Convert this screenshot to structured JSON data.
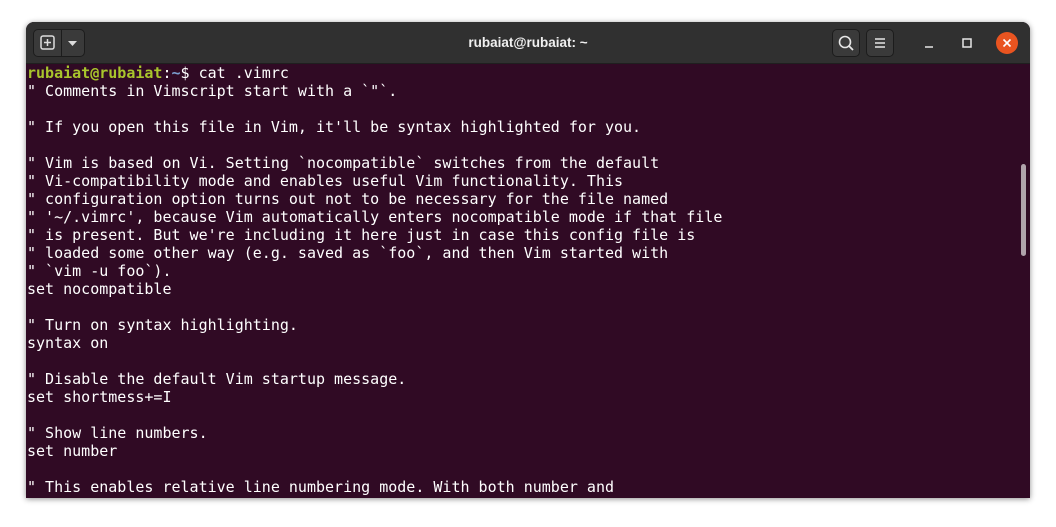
{
  "window": {
    "title": "rubaiat@rubaiat: ~",
    "accent_color": "#e95420",
    "background_color": "#300a24"
  },
  "titlebar": {
    "icons": [
      "new-tab-icon",
      "chevron-down-icon",
      "search-icon",
      "hamburger-menu-icon",
      "minimize-icon",
      "maximize-icon",
      "close-icon"
    ]
  },
  "prompt": {
    "user_host": "rubaiat@rubaiat",
    "separator": ":",
    "path": "~",
    "symbol": "$ ",
    "command": "cat .vimrc"
  },
  "output_lines": [
    "\" Comments in Vimscript start with a `\"`.",
    "",
    "\" If you open this file in Vim, it'll be syntax highlighted for you.",
    "",
    "\" Vim is based on Vi. Setting `nocompatible` switches from the default",
    "\" Vi-compatibility mode and enables useful Vim functionality. This",
    "\" configuration option turns out not to be necessary for the file named",
    "\" '~/.vimrc', because Vim automatically enters nocompatible mode if that file",
    "\" is present. But we're including it here just in case this config file is",
    "\" loaded some other way (e.g. saved as `foo`, and then Vim started with",
    "\" `vim -u foo`).",
    "set nocompatible",
    "",
    "\" Turn on syntax highlighting.",
    "syntax on",
    "",
    "\" Disable the default Vim startup message.",
    "set shortmess+=I",
    "",
    "\" Show line numbers.",
    "set number",
    "",
    "\" This enables relative line numbering mode. With both number and"
  ]
}
